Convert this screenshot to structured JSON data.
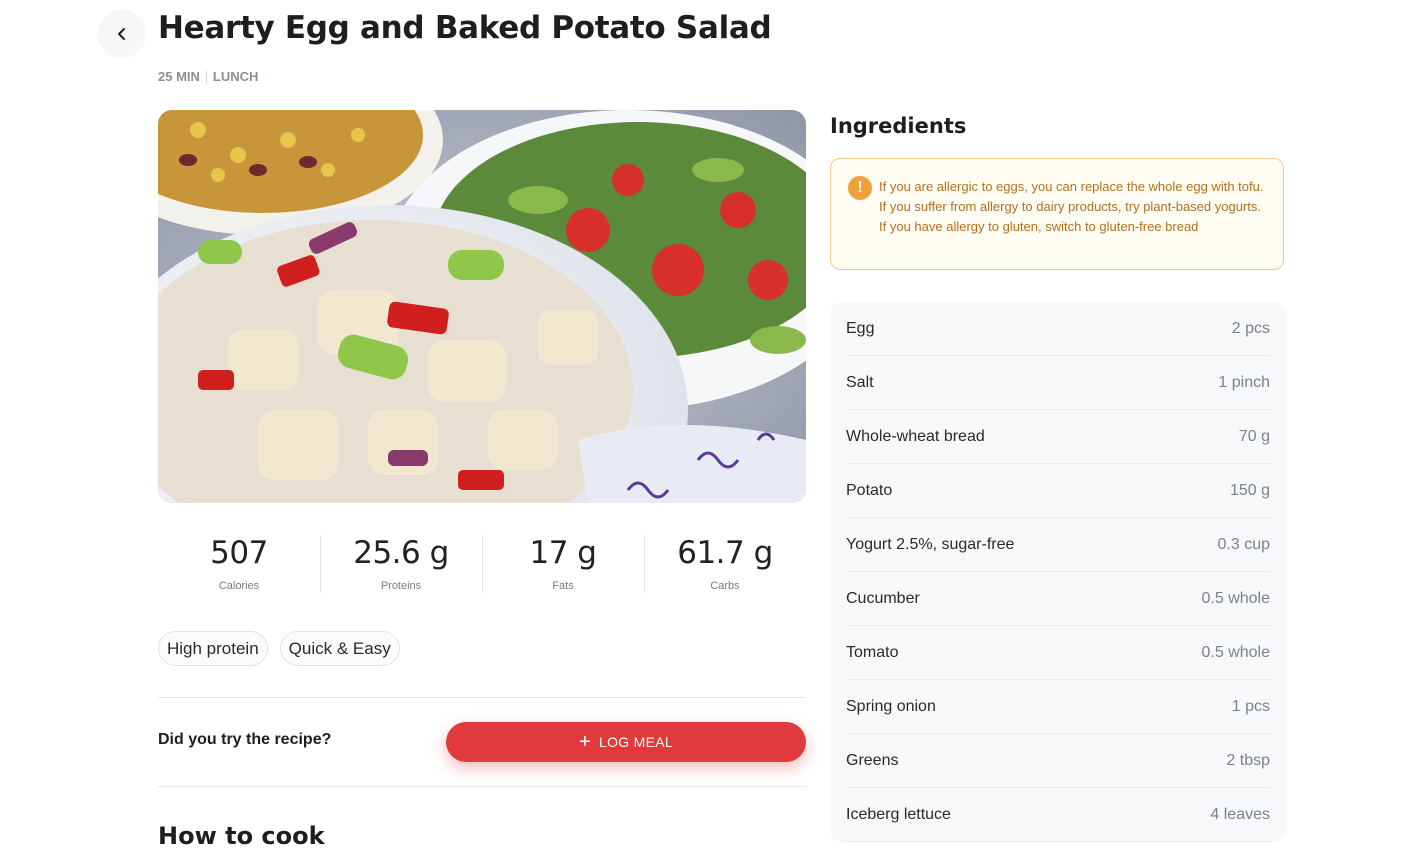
{
  "recipe": {
    "title": "Hearty Egg and Baked Potato Salad",
    "time": "25 MIN",
    "meal_type": "LUNCH"
  },
  "nutrition": [
    {
      "value": "507",
      "label": "Calories"
    },
    {
      "value": "25.6 g",
      "label": "Proteins"
    },
    {
      "value": "17 g",
      "label": "Fats"
    },
    {
      "value": "61.7 g",
      "label": "Carbs"
    }
  ],
  "tags": [
    "High protein",
    "Quick & Easy"
  ],
  "cta": {
    "question": "Did you try the recipe?",
    "button_label": "LOG MEAL"
  },
  "next_section_heading": "How to cook",
  "ingredients": {
    "title": "Ingredients",
    "allergy_note": "If you are allergic to eggs, you can replace the whole egg with tofu. If you suffer from allergy to dairy products, try plant-based yogurts. If you have allergy to gluten, switch to gluten-free bread",
    "items": [
      {
        "name": "Egg",
        "qty": "2 pcs"
      },
      {
        "name": "Salt",
        "qty": "1 pinch"
      },
      {
        "name": "Whole-wheat bread",
        "qty": "70 g"
      },
      {
        "name": "Potato",
        "qty": "150 g"
      },
      {
        "name": "Yogurt 2.5%, sugar-free",
        "qty": "0.3 cup"
      },
      {
        "name": "Cucumber",
        "qty": "0.5 whole"
      },
      {
        "name": "Tomato",
        "qty": "0.5 whole"
      },
      {
        "name": "Spring onion",
        "qty": "1 pcs"
      },
      {
        "name": "Greens",
        "qty": "2 tbsp"
      },
      {
        "name": "Iceberg lettuce",
        "qty": "4 leaves"
      }
    ]
  },
  "colors": {
    "accent": "#e03a3c",
    "warning": "#f0a03a",
    "warning_text": "#b2711e"
  },
  "icons": {
    "back": "chevron-left-icon",
    "warning": "warning-icon",
    "plus": "plus-icon"
  }
}
